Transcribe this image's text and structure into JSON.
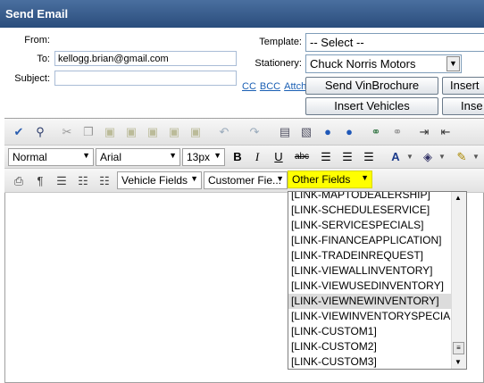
{
  "window": {
    "title": "Send Email"
  },
  "form": {
    "from_label": "From:",
    "to_label": "To:",
    "to_value": "kellogg.brian@gmail.com",
    "subject_label": "Subject:",
    "subject_value": "",
    "cc_label": "CC",
    "bcc_label": "BCC",
    "attch_label": "Attch",
    "template_label": "Template:",
    "template_value": "-- Select --",
    "stationery_label": "Stationery:",
    "stationery_value": "Chuck Norris Motors"
  },
  "buttons": {
    "send_vinbrochure": "Send VinBrochure",
    "insert_partial": "Insert",
    "insert_vehicles": "Insert Vehicles",
    "insert_partial2": "Inse"
  },
  "toolbar": {
    "format_value": "Normal",
    "font_value": "Arial",
    "size_value": "13px",
    "bold": "B",
    "italic": "I",
    "underline": "U",
    "strike": "abc",
    "font_color": "A",
    "vehicle_fields": "Vehicle Fields",
    "customer_fields": "Customer Fie...",
    "other_fields": "Other Fields"
  },
  "other_fields_list": [
    "[LINK-MAPTODEALERSHIP]",
    "[LINK-SCHEDULESERVICE]",
    "[LINK-SERVICESPECIALS]",
    "[LINK-FINANCEAPPLICATION]",
    "[LINK-TRADEINREQUEST]",
    "[LINK-VIEWALLINVENTORY]",
    "[LINK-VIEWUSEDINVENTORY]",
    "[LINK-VIEWNEWINVENTORY]",
    "[LINK-VIEWINVENTORYSPECIALS]",
    "[LINK-CUSTOM1]",
    "[LINK-CUSTOM2]",
    "[LINK-CUSTOM3]"
  ],
  "highlighted_item": "[LINK-VIEWNEWINVENTORY]",
  "colors": {
    "titlebar": "#2a4d7c",
    "highlight_yellow": "#ffff00",
    "link": "#1a5fb4"
  }
}
